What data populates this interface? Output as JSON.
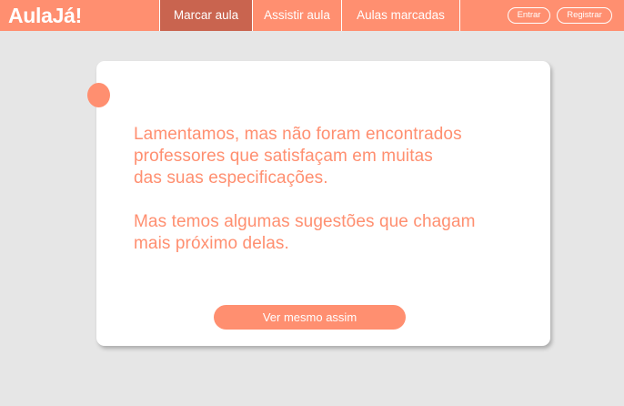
{
  "header": {
    "logo": "AulaJá!",
    "tabs": [
      {
        "label": "Marcar aula",
        "active": true
      },
      {
        "label": "Assistir aula",
        "active": false
      },
      {
        "label": "Aulas marcadas",
        "active": false
      }
    ],
    "login_label": "Entrar",
    "register_label": "Registrar"
  },
  "card": {
    "message_1": "Lamentamos, mas não foram encontrados\nprofessores que satisfaçam em muitas\ndas suas especificações.",
    "message_2": "Mas temos algumas sugestões que chagam\nmais próximo delas.",
    "button_label": "Ver mesmo assim"
  },
  "colors": {
    "accent": "#ff8f70",
    "active_tab": "#c9644f",
    "background": "#e6e6e6"
  }
}
